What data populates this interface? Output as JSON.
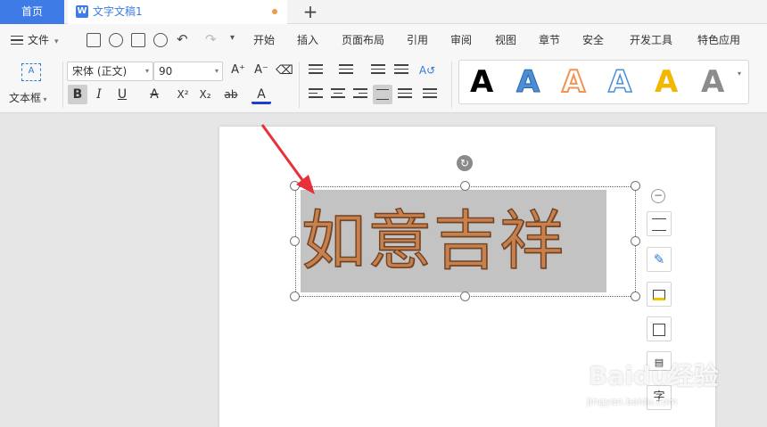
{
  "tabs": {
    "home": "首页",
    "doc_icon": "W",
    "doc_title": "文字文稿1",
    "add": "+"
  },
  "menu": {
    "file": "文件",
    "items": [
      "开始",
      "插入",
      "页面布局",
      "引用",
      "审阅",
      "视图",
      "章节",
      "安全",
      "开发工具",
      "特色应用"
    ]
  },
  "ribbon": {
    "textbox_label": "文本框",
    "textbox_icon": "A",
    "font_name": "宋体 (正文)",
    "font_size": "90",
    "bold": "B",
    "italic": "I",
    "underline": "U",
    "strike": "A",
    "superscript": "X²",
    "subscript": "X₂",
    "highlight": "ab",
    "font_color": "A",
    "grow": "A⁺",
    "shrink": "A⁻",
    "gallery_glyph": "A",
    "gallery_colors": [
      "#000000",
      "#4a8fd6",
      "#f29455",
      "#4a8fd6",
      "#f2b700",
      "#8c8c8c"
    ]
  },
  "document": {
    "art_text": "如意吉祥",
    "art_fill": "#c8804d",
    "art_stroke": "#6f4326",
    "box_fill": "#c3c3c3"
  },
  "side_toolbar": {
    "collapse": "−",
    "last_label": "字"
  },
  "watermark": {
    "brand": "Baidu经验",
    "url": "jingyan.baidu.com"
  },
  "colors": {
    "accent": "#3f7be6",
    "annotation_arrow": "#e8303a"
  }
}
